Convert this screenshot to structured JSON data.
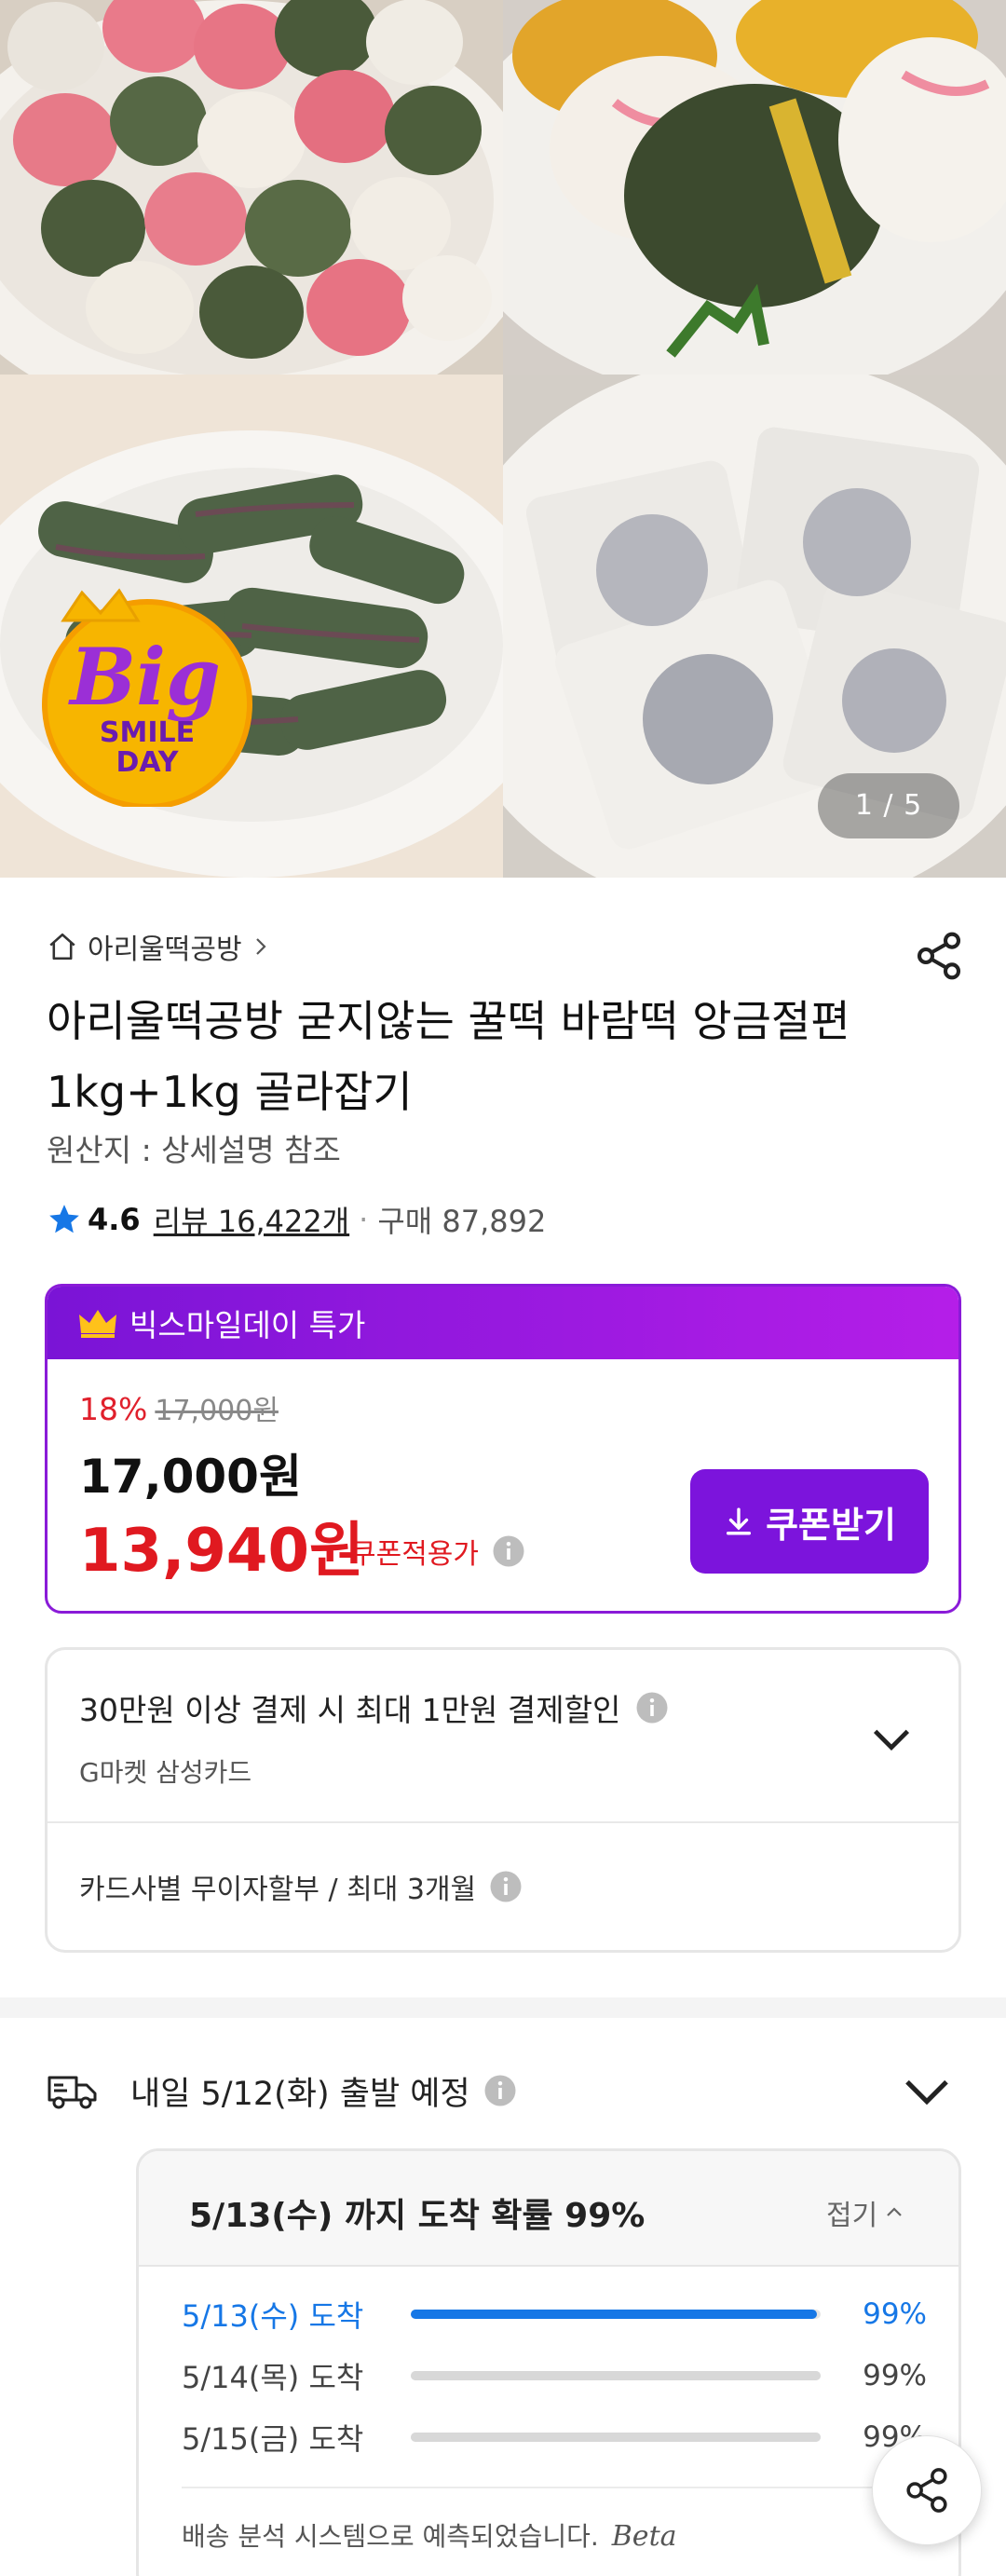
{
  "gallery": {
    "counter": "1 / 5",
    "badge": {
      "line1": "Big",
      "line2": "SMILE",
      "line3": "DAY"
    }
  },
  "store": {
    "name": "아리울떡공방"
  },
  "product": {
    "title": "아리울떡공방 굳지않는 꿀떡 바람떡 앙금절편 1kg+1kg 골라잡기",
    "origin": "원산지 : 상세설명 참조",
    "rating": "4.6",
    "reviews": "리뷰 16,422개",
    "separator": "·",
    "purchases": "구매 87,892"
  },
  "deal": {
    "title": "빅스마일데이 특가",
    "discount_pct": "18%",
    "original_price": "17,000원",
    "price": "17,000원",
    "coupon_price": "13,940원",
    "coupon_note": "쿠폰적용가",
    "coupon_button": "쿠폰받기"
  },
  "payment": {
    "benefit": "30만원 이상 결제 시 최대 1만원 결제할인",
    "card": "G마켓 삼성카드",
    "installment": "카드사별 무이자할부 / 최대 3개월"
  },
  "delivery": {
    "departure": "내일 5/12(화) 출발 예정",
    "probability_title": "5/13(수) 까지 도착 확률 99%",
    "fold_label": "접기",
    "rows": [
      {
        "day": "5/13(수) 도착",
        "pct": "99%",
        "value": 0.99,
        "active": true
      },
      {
        "day": "5/14(목) 도착",
        "pct": "99%",
        "value": 0.99,
        "active": false
      },
      {
        "day": "5/15(금) 도착",
        "pct": "99%",
        "value": 0.99,
        "active": false
      }
    ],
    "note": "배송 분석 시스템으로 예측되었습니다.",
    "beta": "Beta"
  },
  "colors": {
    "deal_purple": "#7c14dc",
    "price_red": "#e01920",
    "accent_blue": "#1677e6"
  },
  "icons": [
    "home-icon",
    "chevron-right-icon",
    "share-icon",
    "star-icon",
    "crown-icon",
    "download-icon",
    "info-icon",
    "chevron-down-icon",
    "truck-icon",
    "chevron-up-icon"
  ]
}
